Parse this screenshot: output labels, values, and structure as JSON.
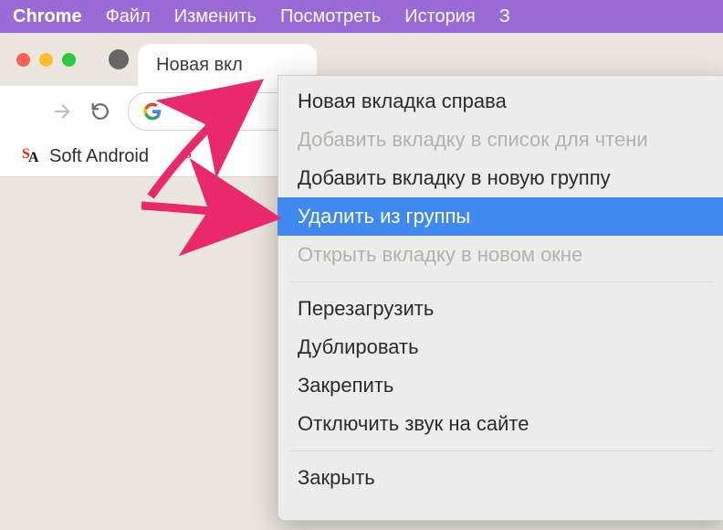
{
  "menubar": {
    "app_name": "Chrome",
    "items": [
      "Файл",
      "Изменить",
      "Посмотреть",
      "История",
      "З"
    ]
  },
  "tabstrip": {
    "tab_title_visible": "Новая вкл"
  },
  "bookmarks": {
    "items": [
      {
        "label": "Soft Android"
      }
    ]
  },
  "context_menu": {
    "items": [
      {
        "label": "Новая вкладка справа",
        "disabled": false,
        "highlighted": false
      },
      {
        "label": "Добавить вкладку в список для чтени",
        "disabled": true,
        "highlighted": false
      },
      {
        "label": "Добавить вкладку в новую группу",
        "disabled": false,
        "highlighted": false
      },
      {
        "label": "Удалить из группы",
        "disabled": false,
        "highlighted": true
      },
      {
        "label": "Открыть вкладку в новом окне",
        "disabled": true,
        "highlighted": false
      },
      {
        "sep": true
      },
      {
        "label": "Перезагрузить",
        "disabled": false,
        "highlighted": false
      },
      {
        "label": "Дублировать",
        "disabled": false,
        "highlighted": false
      },
      {
        "label": "Закрепить",
        "disabled": false,
        "highlighted": false
      },
      {
        "label": "Отключить звук на сайте",
        "disabled": false,
        "highlighted": false
      },
      {
        "sep": true
      },
      {
        "label": "Закрыть",
        "disabled": false,
        "highlighted": false
      }
    ]
  }
}
